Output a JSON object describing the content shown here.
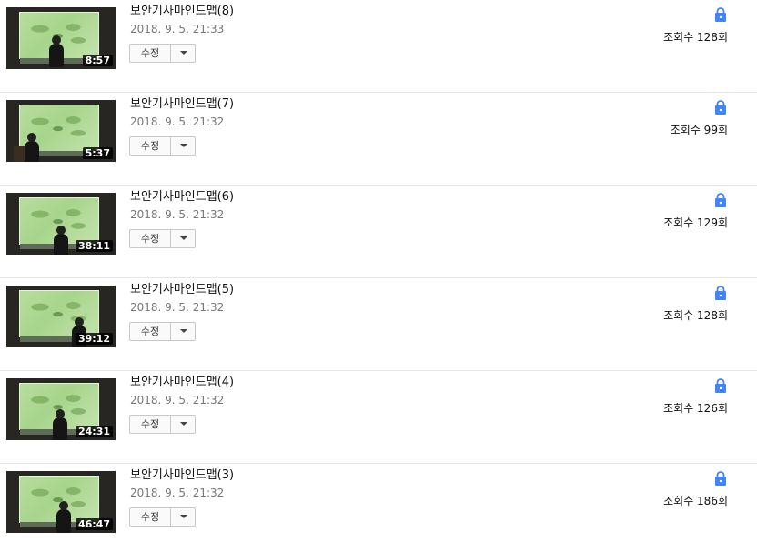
{
  "videos": [
    {
      "title": "보안기사마인드맵(8)",
      "date": "2018. 9. 5. 21:33",
      "duration": "8:57",
      "views": "조회수 128회",
      "edit_label": "수정",
      "icon": "lock-icon"
    },
    {
      "title": "보안기사마인드맵(7)",
      "date": "2018. 9. 5. 21:32",
      "duration": "5:37",
      "views": "조회수 99회",
      "edit_label": "수정",
      "icon": "lock-icon"
    },
    {
      "title": "보안기사마인드맵(6)",
      "date": "2018. 9. 5. 21:32",
      "duration": "38:11",
      "views": "조회수 129회",
      "edit_label": "수정",
      "icon": "lock-icon"
    },
    {
      "title": "보안기사마인드맵(5)",
      "date": "2018. 9. 5. 21:32",
      "duration": "39:12",
      "views": "조회수 128회",
      "edit_label": "수정",
      "icon": "lock-icon"
    },
    {
      "title": "보안기사마인드맵(4)",
      "date": "2018. 9. 5. 21:32",
      "duration": "24:31",
      "views": "조회수 126회",
      "edit_label": "수정",
      "icon": "lock-icon"
    },
    {
      "title": "보안기사마인드맵(3)",
      "date": "2018. 9. 5. 21:32",
      "duration": "46:47",
      "views": "조회수 186회",
      "edit_label": "수정",
      "icon": "lock-icon"
    }
  ],
  "colors": {
    "lock_icon": "#4285f4",
    "thumbnail_screen": "#b7dd9d",
    "duration_badge": "#000000"
  }
}
